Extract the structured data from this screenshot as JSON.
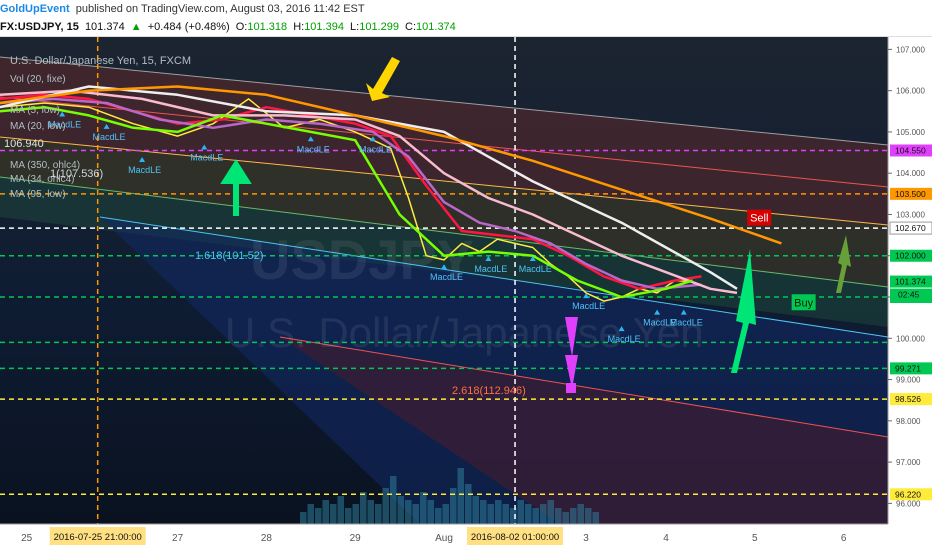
{
  "header": {
    "author": "GoldUpEvent",
    "published_text": "published on TradingView.com, August 03, 2016 11:42 EST",
    "symbol": "FX:USDJPY, 15",
    "last": "101.374",
    "change": "+0.484 (+0.48%)",
    "o_label": "O:",
    "o": "101.318",
    "h_label": "H:",
    "h": "101.394",
    "l_label": "L:",
    "l": "101.299",
    "c_label": "C:",
    "c": "101.374"
  },
  "chart_data": {
    "type": "line",
    "title": "U.S. Dollar/Japanese Yen, 15, FXCM",
    "watermark_symbol": "USDJPY",
    "watermark_name": "U.S. Dollar/Japanese Yen",
    "indicator_labels": [
      "Vol (20, fixe)",
      "MA (5, low)",
      "MA (20, low)",
      "106.940",
      "MA (350, ohlc4)",
      "MA (34, ohlc4)",
      "MA (95, low)"
    ],
    "fib_labels": [
      "1(107.536)",
      "1.618(101.52)",
      "2.618(112.946)"
    ],
    "y_axis": {
      "ylim": [
        95.5,
        107.3
      ],
      "ticks": [
        107.0,
        106.0,
        105.0,
        104.0,
        103.0,
        102.0,
        101.0,
        100.0,
        99.0,
        98.0,
        97.0,
        96.0
      ],
      "tick_labels": [
        "107.000",
        "106.000",
        "105.000",
        "104.000",
        "103.000",
        "102.000",
        "101.000",
        "100.000",
        "99.000",
        "98.000",
        "97.000",
        "96.000"
      ],
      "price_tags": [
        {
          "value": 104.55,
          "label": "104.550",
          "color": "#e040fb"
        },
        {
          "value": 103.5,
          "label": "103.500",
          "color": "#ff9800"
        },
        {
          "value": 102.67,
          "label": "102.670",
          "color": "#ffffff"
        },
        {
          "value": 102.0,
          "label": "102.000",
          "color": "#00c853"
        },
        {
          "value": 101.374,
          "label": "101.374",
          "color": "#00c853"
        },
        {
          "value": 101.0,
          "label": "101.000",
          "color": "#00c853"
        },
        {
          "value": 99.271,
          "label": "99.271",
          "color": "#00c853"
        },
        {
          "value": 98.526,
          "label": "98.526",
          "color": "#ffeb3b"
        },
        {
          "value": 96.22,
          "label": "96.220",
          "color": "#ffeb3b"
        }
      ],
      "countdown": "02:45"
    },
    "x_axis": {
      "labels": [
        "25",
        "27",
        "28",
        "29",
        "Aug",
        "3",
        "4",
        "5",
        "6"
      ],
      "x": [
        0.3,
        2.0,
        3.0,
        4.0,
        5.0,
        6.6,
        7.5,
        8.5,
        9.5
      ],
      "xlim": [
        0.0,
        10.0
      ],
      "highlight": [
        {
          "x": 1.1,
          "label": "2016-07-25 21:00:00"
        },
        {
          "x": 5.8,
          "label": "2016-08-02 01:00:00"
        }
      ]
    },
    "hlines": [
      {
        "y": 104.55,
        "color": "#e040fb",
        "style": "dash"
      },
      {
        "y": 103.5,
        "color": "#ff9800",
        "style": "dash"
      },
      {
        "y": 102.67,
        "color": "#ffffff",
        "style": "dash"
      },
      {
        "y": 102.0,
        "color": "#00c853",
        "style": "dash"
      },
      {
        "y": 101.0,
        "color": "#00c853",
        "style": "dash"
      },
      {
        "y": 99.9,
        "color": "#00c853",
        "style": "dash"
      },
      {
        "y": 99.271,
        "color": "#00c853",
        "style": "dash"
      },
      {
        "y": 98.526,
        "color": "#ffeb3b",
        "style": "dash"
      },
      {
        "y": 96.22,
        "color": "#ffeb3b",
        "style": "dash"
      }
    ],
    "vlines": [
      {
        "x": 1.1,
        "color": "#ff9800"
      },
      {
        "x": 5.8,
        "color": "#ffffff"
      }
    ],
    "series": [
      {
        "name": "USDJPY close",
        "color": "#ffeb3b",
        "x": [
          0.0,
          0.5,
          1.0,
          1.5,
          2.0,
          2.4,
          2.8,
          3.2,
          3.6,
          4.0,
          4.4,
          4.6,
          4.8,
          5.0,
          5.2,
          5.4,
          5.6,
          5.8,
          6.0,
          6.2,
          6.4,
          6.6,
          6.8,
          7.0,
          7.2,
          7.4,
          7.6,
          7.8
        ],
        "values": [
          105.6,
          105.7,
          105.6,
          105.2,
          104.9,
          105.2,
          105.8,
          105.1,
          105.3,
          105.0,
          104.6,
          103.4,
          102.0,
          101.9,
          102.3,
          102.1,
          102.4,
          102.3,
          102.2,
          101.8,
          101.5,
          101.1,
          100.9,
          101.0,
          101.2,
          101.1,
          101.4,
          101.37
        ]
      },
      {
        "name": "MA (5, low)",
        "color": "#ff1744",
        "x": [
          0.0,
          0.5,
          1.0,
          1.5,
          2.0,
          2.5,
          3.0,
          3.5,
          4.0,
          4.4,
          4.8,
          5.2,
          5.6,
          6.0,
          6.4,
          6.8,
          7.2,
          7.6,
          7.9
        ],
        "values": [
          105.8,
          105.9,
          105.8,
          105.5,
          105.2,
          105.3,
          105.6,
          105.4,
          105.2,
          104.9,
          103.7,
          102.6,
          102.5,
          102.4,
          102.0,
          101.5,
          101.2,
          101.4,
          101.5
        ]
      },
      {
        "name": "MA (20, low)",
        "color": "#ba68c8",
        "x": [
          0.0,
          0.6,
          1.2,
          1.8,
          2.4,
          3.0,
          3.6,
          4.2,
          4.6,
          5.0,
          5.4,
          5.8,
          6.2,
          6.6,
          7.0,
          7.4,
          7.9
        ],
        "values": [
          105.7,
          105.8,
          105.7,
          105.3,
          105.1,
          105.3,
          105.2,
          105.0,
          104.4,
          103.3,
          102.8,
          102.6,
          102.3,
          101.8,
          101.4,
          101.2,
          101.3
        ]
      },
      {
        "name": "MA (34, ohlc4)",
        "color": "#f8bbd0",
        "x": [
          0.0,
          0.8,
          1.6,
          2.4,
          3.2,
          4.0,
          4.5,
          5.0,
          5.5,
          6.0,
          6.5,
          7.0,
          7.5,
          8.0,
          8.3
        ],
        "values": [
          105.9,
          106.0,
          105.8,
          105.4,
          105.4,
          105.3,
          104.9,
          104.0,
          103.4,
          103.0,
          102.5,
          102.0,
          101.6,
          101.2,
          101.1
        ]
      },
      {
        "name": "MA (95, low)",
        "color": "#eeeeee",
        "x": [
          0.0,
          1.0,
          2.0,
          3.0,
          4.0,
          5.0,
          5.5,
          6.0,
          6.5,
          7.0,
          7.5,
          8.0,
          8.3
        ],
        "values": [
          105.6,
          106.1,
          105.9,
          105.5,
          105.4,
          105.0,
          104.4,
          103.8,
          103.3,
          102.8,
          102.2,
          101.6,
          101.2
        ]
      },
      {
        "name": "MA (350, ohlc4)",
        "color": "#ff9800",
        "x": [
          0.0,
          1.0,
          2.0,
          3.0,
          4.0,
          5.0,
          6.0,
          7.0,
          8.0,
          8.8
        ],
        "values": [
          105.7,
          106.0,
          106.1,
          105.9,
          105.4,
          104.9,
          104.3,
          103.6,
          102.9,
          102.3
        ]
      },
      {
        "name": "MA fast",
        "color": "#76ff03",
        "x": [
          0.0,
          0.5,
          1.0,
          1.5,
          2.0,
          2.5,
          3.0,
          3.5,
          4.0,
          4.5,
          5.0,
          5.5,
          6.0,
          6.5,
          7.0,
          7.5,
          7.8
        ],
        "values": [
          105.5,
          105.6,
          105.4,
          105.1,
          105.0,
          105.4,
          105.2,
          105.0,
          104.8,
          103.0,
          102.0,
          102.1,
          102.0,
          101.4,
          101.0,
          101.2,
          101.4
        ]
      }
    ],
    "markers": [
      {
        "text": "MacdLE",
        "x": 0.7,
        "y": 105.3
      },
      {
        "text": "MacdLE",
        "x": 1.2,
        "y": 105.0
      },
      {
        "text": "MacdLE",
        "x": 1.6,
        "y": 104.2
      },
      {
        "text": "MacdLE",
        "x": 2.3,
        "y": 104.5
      },
      {
        "text": "MacdLE",
        "x": 3.5,
        "y": 104.7
      },
      {
        "text": "MacdLE",
        "x": 4.2,
        "y": 104.7
      },
      {
        "text": "MacdLE",
        "x": 5.0,
        "y": 101.6
      },
      {
        "text": "MacdLE",
        "x": 5.5,
        "y": 101.8
      },
      {
        "text": "MacdLE",
        "x": 6.0,
        "y": 101.8
      },
      {
        "text": "MacdLE",
        "x": 6.6,
        "y": 100.9
      },
      {
        "text": "MacdLE",
        "x": 7.0,
        "y": 100.1
      },
      {
        "text": "MacdLE",
        "x": 7.4,
        "y": 100.5
      },
      {
        "text": "MacdLE",
        "x": 7.7,
        "y": 100.5
      }
    ],
    "annotations": [
      {
        "text": "Sell",
        "x": 8.55,
        "y": 102.85
      },
      {
        "text": "Buy",
        "x": 9.05,
        "y": 100.8
      }
    ],
    "volume": [
      3,
      5,
      4,
      6,
      5,
      7,
      4,
      5,
      8,
      6,
      5,
      9,
      12,
      7,
      6,
      5,
      8,
      6,
      4,
      5,
      9,
      14,
      10,
      7,
      6,
      5,
      6,
      5,
      4,
      6,
      5,
      4,
      5,
      6,
      4,
      3,
      4,
      5,
      4,
      3
    ]
  },
  "colors": {
    "background": "#0c1b2e",
    "axis_bg": "#ffffff",
    "up": "#00c853",
    "down": "#ff1744"
  }
}
